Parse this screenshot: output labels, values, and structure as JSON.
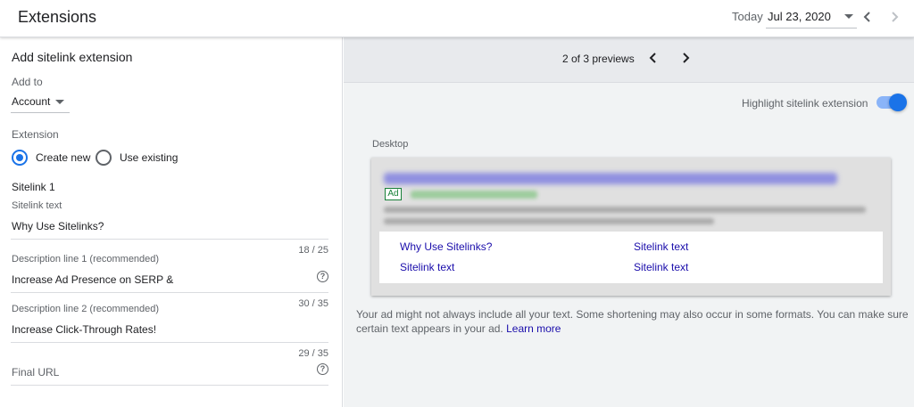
{
  "header": {
    "title": "Extensions",
    "today_label": "Today",
    "date_value": "Jul 23, 2020",
    "prev_icon": "chevron-left-icon",
    "next_icon": "chevron-right-icon"
  },
  "form": {
    "title": "Add sitelink extension",
    "add_to_label": "Add to",
    "add_to_value": "Account",
    "extension_label": "Extension",
    "radio_create_new": "Create new",
    "radio_use_existing": "Use existing",
    "selected_option": "Create new",
    "sitelink_heading": "Sitelink 1",
    "sitelink_text_label": "Sitelink text",
    "sitelink_text_value": "Why Use Sitelinks?",
    "sitelink_counter": "18 / 25",
    "desc1_label": "Description line 1 (recommended)",
    "desc1_value": "Increase Ad Presence on SERP &",
    "desc1_counter": "30 / 35",
    "desc2_label": "Description line 2 (recommended)",
    "desc2_value": "Increase Click-Through Rates!",
    "desc2_counter": "29 / 35",
    "final_url_label": "Final URL",
    "help_icon": "help-circle-icon"
  },
  "preview": {
    "count_text": "2 of 3 previews",
    "highlight_label": "Highlight sitelink extension",
    "highlight_on": true,
    "desktop_label": "Desktop",
    "ad_badge": "Ad",
    "sitelinks": [
      "Why Use Sitelinks?",
      "Sitelink text",
      "Sitelink text",
      "Sitelink text"
    ],
    "disclaimer": "Your ad might not always include all your text. Some shortening may also occur in some formats. You can make sure certain text appears in your ad.",
    "learn_more": "Learn more"
  },
  "colors": {
    "accent": "#1a73e8",
    "link": "#1a0dab",
    "ad_green": "#188038"
  }
}
